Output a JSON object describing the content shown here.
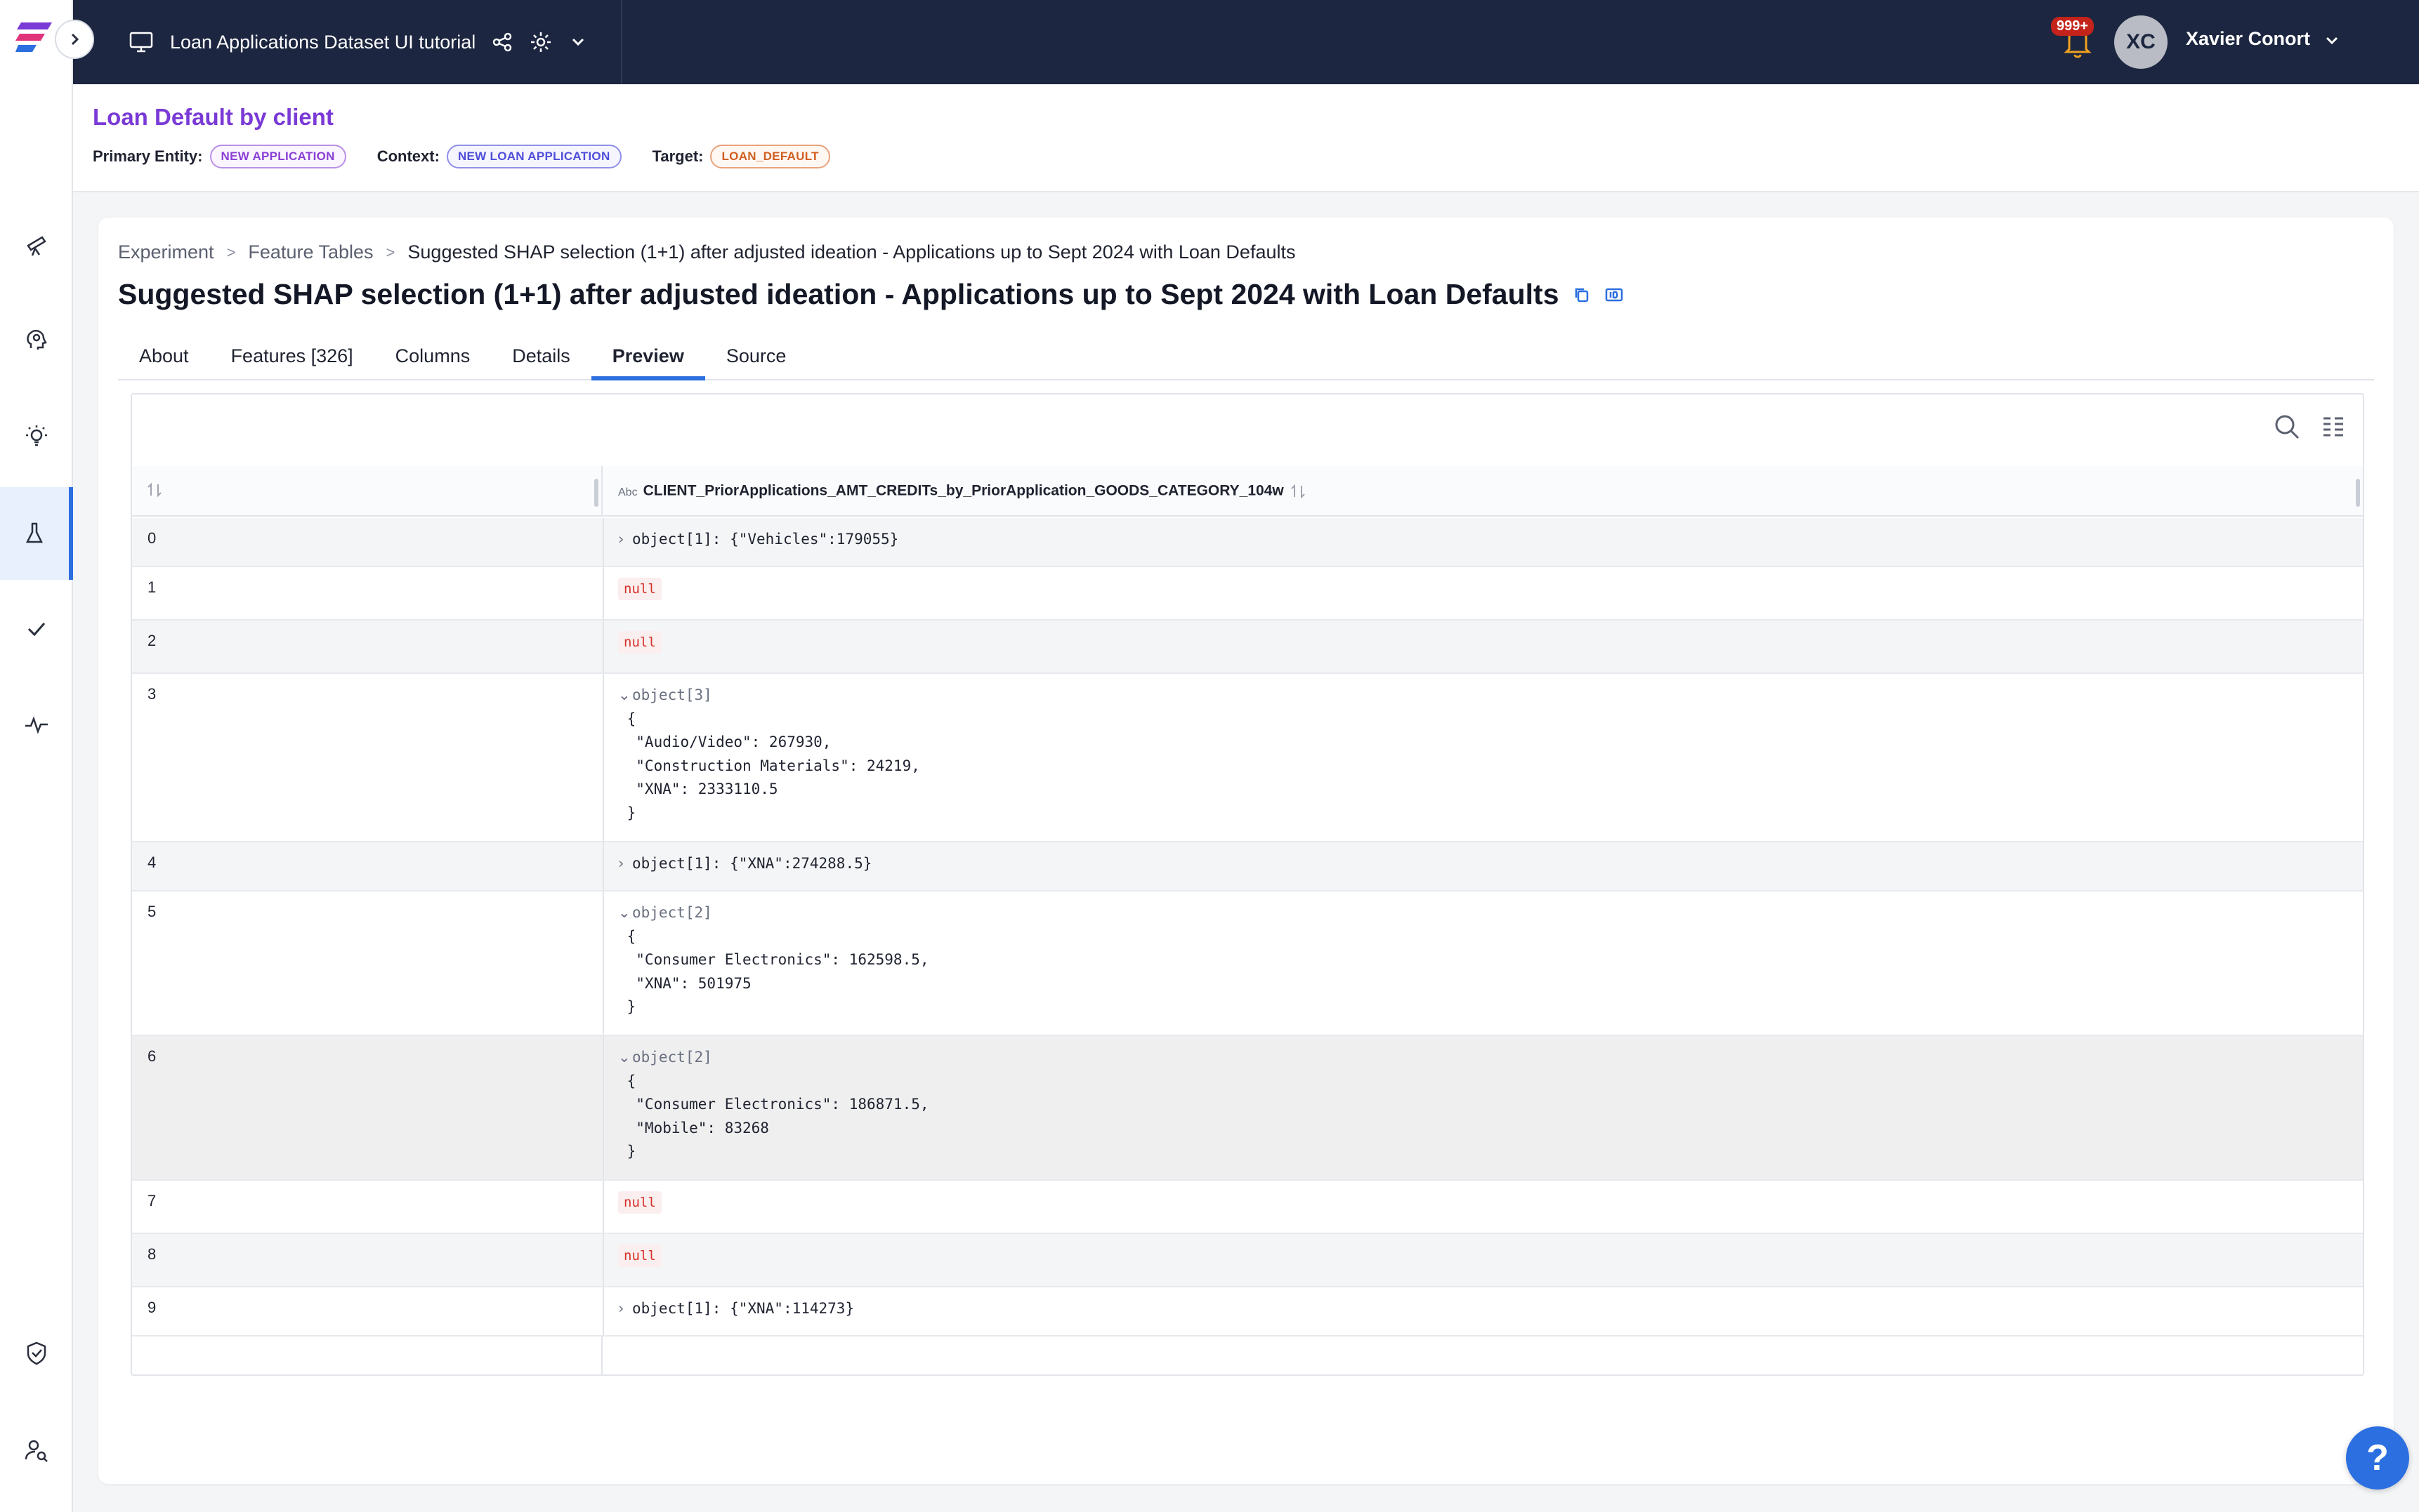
{
  "topbar": {
    "app_title": "Loan Applications Dataset UI tutorial",
    "notifications_badge": "999+",
    "user_initials": "XC",
    "user_name": "Xavier Conort"
  },
  "use_case": {
    "title": "Loan Default by client",
    "primary_entity_label": "Primary Entity:",
    "primary_entity_value": "NEW APPLICATION",
    "context_label": "Context:",
    "context_value": "NEW LOAN APPLICATION",
    "target_label": "Target:",
    "target_value": "LOAN_DEFAULT"
  },
  "breadcrumb": {
    "items": [
      "Experiment",
      "Feature Tables",
      "Suggested SHAP selection (1+1) after adjusted ideation - Applications up to Sept 2024 with Loan Defaults"
    ],
    "separator": ">"
  },
  "page": {
    "title": "Suggested SHAP selection (1+1) after adjusted ideation - Applications up to Sept 2024 with Loan Defaults"
  },
  "tabs": [
    {
      "label": "About"
    },
    {
      "label": "Features [326]"
    },
    {
      "label": "Columns"
    },
    {
      "label": "Details"
    },
    {
      "label": "Preview",
      "active": true
    },
    {
      "label": "Source"
    }
  ],
  "grid": {
    "column_type": "Abc",
    "column_header": "CLIENT_PriorApplications_AMT_CREDITs_by_PriorApplication_GOODS_CATEGORY_104w",
    "rows": [
      {
        "index": "0",
        "chevron": ">",
        "label": "object[1]:",
        "value": " {\"Vehicles\":179055}"
      },
      {
        "index": "1",
        "null": "null"
      },
      {
        "index": "2",
        "null": "null"
      },
      {
        "index": "3",
        "chevron": "v",
        "label": "object[3]",
        "value": "\n {\n  \"Audio/Video\": 267930,\n  \"Construction Materials\": 24219,\n  \"XNA\": 2333110.5\n }"
      },
      {
        "index": "4",
        "chevron": ">",
        "label": "object[1]:",
        "value": " {\"XNA\":274288.5}"
      },
      {
        "index": "5",
        "chevron": "v",
        "label": "object[2]",
        "value": "\n {\n  \"Consumer Electronics\": 162598.5,\n  \"XNA\": 501975\n }"
      },
      {
        "index": "6",
        "chevron": "v",
        "label": "object[2]",
        "value": "\n {\n  \"Consumer Electronics\": 186871.5,\n  \"Mobile\": 83268\n }"
      },
      {
        "index": "7",
        "null": "null"
      },
      {
        "index": "8",
        "null": "null"
      },
      {
        "index": "9",
        "chevron": ">",
        "label": "object[1]:",
        "value": " {\"XNA\":114273}"
      }
    ]
  },
  "help": {
    "label": "?"
  },
  "colors": {
    "accent": "#2b6fe0",
    "topbar": "#1c2640",
    "title_purple": "#7a3ad6"
  }
}
